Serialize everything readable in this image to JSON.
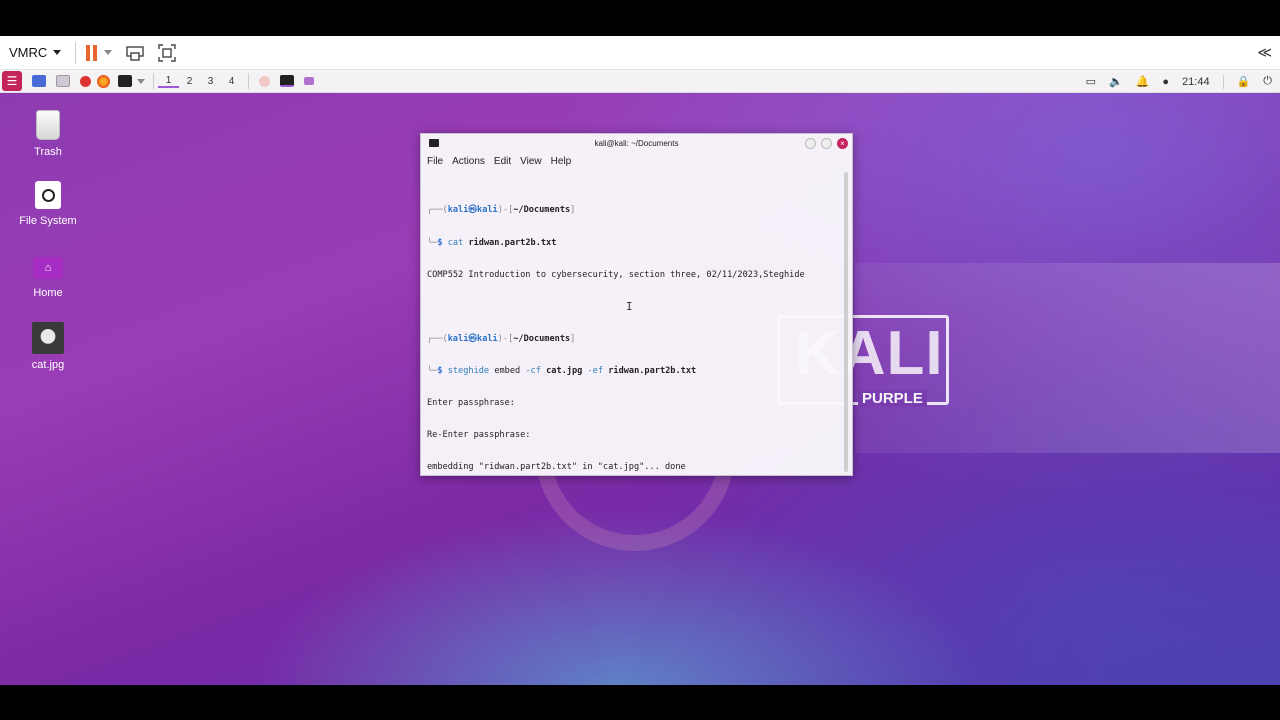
{
  "vmrc": {
    "menu_label": "VMRC",
    "collapse_glyph": "≪"
  },
  "panel": {
    "workspaces": [
      "1",
      "2",
      "3",
      "4"
    ],
    "active_workspace": "1",
    "clock": "21:44"
  },
  "desktop": {
    "icons": [
      {
        "label": "Trash"
      },
      {
        "label": "File System"
      },
      {
        "label": "Home"
      },
      {
        "label": "cat.jpg"
      }
    ],
    "wallpaper": {
      "brand": "KALI",
      "sub": "PURPLE"
    }
  },
  "terminal": {
    "title": "kali@kali: ~/Documents",
    "menu": [
      "File",
      "Actions",
      "Edit",
      "View",
      "Help"
    ],
    "prompt_user": "kali",
    "prompt_host": "kali",
    "prompt_dir": "~/Documents",
    "cmd1_name": "cat",
    "cmd1_args": "ridwan.part2b.txt",
    "out1": "COMP552 Introduction to cybersecurity, section three, 02/11/2023,Steghide",
    "cmd2_name": "steghide",
    "cmd2_sub": "embed",
    "cmd2_flag1": "-cf",
    "cmd2_arg1": "cat.jpg",
    "cmd2_flag2": "-ef",
    "cmd2_arg2": "ridwan.part2b.txt",
    "out2_1": "Enter passphrase:",
    "out2_2": "Re-Enter passphrase:",
    "out2_3": "embedding \"ridwan.part2b.txt\" in \"cat.jpg\"... done"
  }
}
